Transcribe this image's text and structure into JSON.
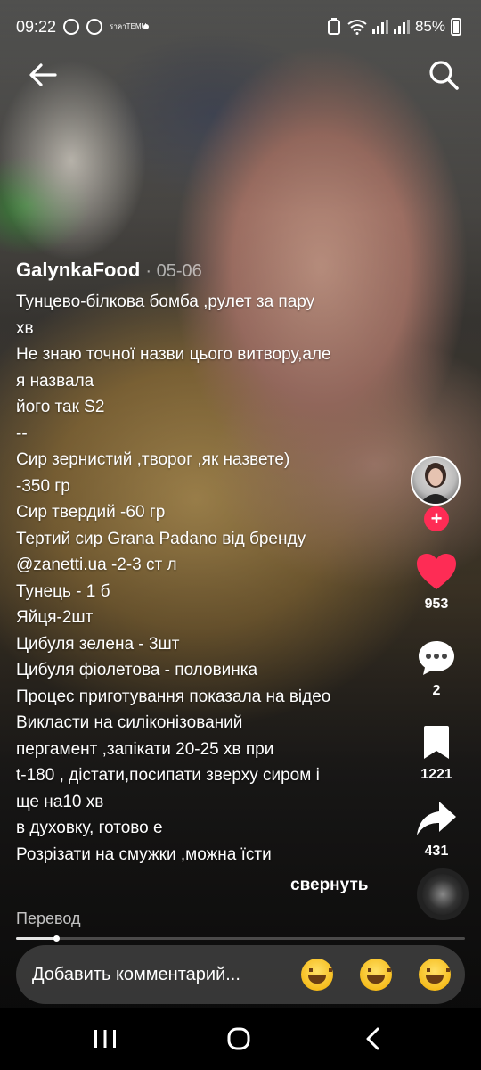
{
  "status_bar": {
    "time": "09:22",
    "temu_label": "ราคาTEMU",
    "battery": "85%"
  },
  "author": {
    "name": "GalynkaFood",
    "date": "· 05-06"
  },
  "description_lines": [
    "Тунцево-білкова бомба ,рулет за пару",
    "хв",
    "Не знаю точної назви цього витвору,але",
    "я назвала",
    "його так S2",
    "--",
    "Сир зернистий ,творог ,як назвете)",
    "-350 гр",
    "Сир твердий -60 гр",
    "Тертий сир Grana Padano від бренду",
    "@zanetti.ua -2-3 ст л",
    "Тунець - 1 б",
    "Яйця-2шт",
    "Цибуля зелена - 3шт",
    "Цибуля фіолетова - половинка",
    "Процес приготування показала на відео",
    "Викласти на силіконізований",
    "пергамент ,запікати 20-25 хв при",
    "t-180 , дістати,посипати зверху сиром і",
    "ще на10 хв",
    "в духовку, готово е",
    "Розрізати на смужки ,можна їсти"
  ],
  "collapse_label": "свернуть",
  "translate_label": "Перевод",
  "video_progress": 0.09,
  "actions": {
    "likes": "953",
    "comments": "2",
    "saves": "1221",
    "shares": "431"
  },
  "comment_bar": {
    "placeholder": "Добавить комментарий..."
  },
  "icons": {
    "back": "arrow-left-icon",
    "search": "search-icon",
    "like": "heart-icon",
    "comment": "speech-bubble-icon",
    "save": "bookmark-icon",
    "share": "share-arrow-icon",
    "follow": "plus-icon"
  },
  "colors": {
    "like": "#fe2c55",
    "follow": "#fe2c55"
  }
}
